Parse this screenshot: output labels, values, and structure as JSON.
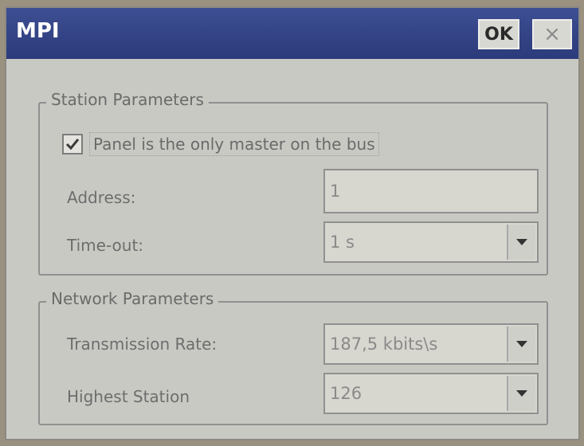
{
  "window": {
    "title": "MPI",
    "ok_label": "OK",
    "close_label": "×"
  },
  "station_params": {
    "legend": "Station Parameters",
    "only_master_label": "Panel is the only master on the bus",
    "only_master_checked": true,
    "address_label": "Address:",
    "address_value": "1",
    "timeout_label": "Time-out:",
    "timeout_value": "1 s"
  },
  "network_params": {
    "legend": "Network Parameters",
    "rate_label": "Transmission Rate:",
    "rate_value": "187,5 kbits\\s",
    "highest_label": "Highest Station",
    "highest_value": "126"
  }
}
